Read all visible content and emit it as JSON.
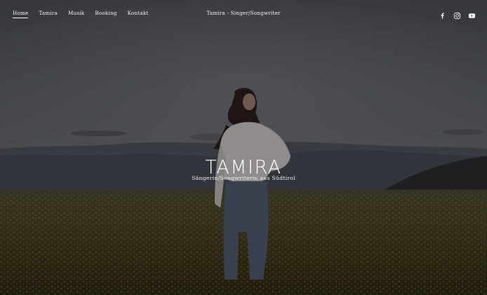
{
  "nav": {
    "items": [
      {
        "label": "Home",
        "active": true
      },
      {
        "label": "Tamira",
        "active": false
      },
      {
        "label": "Musik",
        "active": false
      },
      {
        "label": "Booking",
        "active": false
      },
      {
        "label": "Kontakt",
        "active": false
      }
    ]
  },
  "header": {
    "site_title": "Tamira - Singer/Songwriter"
  },
  "social": {
    "icons": [
      "facebook-icon",
      "instagram-icon",
      "youtube-icon"
    ]
  },
  "hero": {
    "title": "TAMIRA",
    "subtitle": "Sängerin/Songwriterin aus Südtirol"
  },
  "colors": {
    "overlay": "#000000",
    "text": "#ffffff",
    "sky": "#5a5f68",
    "meadow": "#4a4426",
    "flowers": "#8a7a2c"
  }
}
